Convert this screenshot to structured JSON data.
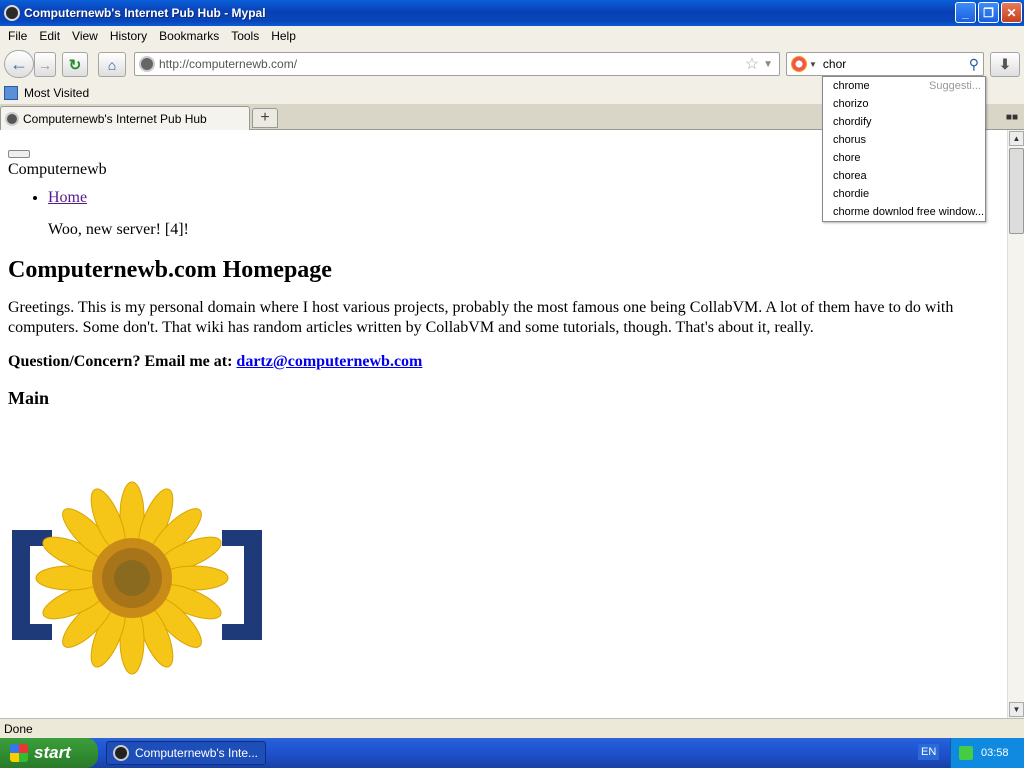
{
  "window": {
    "title": "Computernewb's Internet Pub Hub - Mypal",
    "minimize": "_",
    "restore": "❐",
    "close": "✕"
  },
  "menu": [
    "File",
    "Edit",
    "View",
    "History",
    "Bookmarks",
    "Tools",
    "Help"
  ],
  "nav": {
    "back_icon": "arrow-left-icon",
    "forward_icon": "arrow-right-icon",
    "reload_icon": "reload-icon",
    "home_icon": "home-icon",
    "url": "http://computernewb.com/",
    "search_query": "chor",
    "download_icon": "download-icon"
  },
  "bookmarks": {
    "most_visited": "Most Visited"
  },
  "tabs": [
    {
      "label": "Computernewb's Internet Pub Hub"
    }
  ],
  "new_tab": "+",
  "suggestions": {
    "hint": "Suggesti...",
    "items": [
      "chrome",
      "chorizo",
      "chordify",
      "chorus",
      "chore",
      "chorea",
      "chordie",
      "chorme downlod free window..."
    ]
  },
  "page": {
    "brand": "Computernewb",
    "nav_links": [
      "Home"
    ],
    "news": "Woo, new server! [4]!",
    "heading": "Computernewb.com Homepage",
    "intro": "Greetings. This is my personal domain where I host various projects, probably the most famous one being CollabVM. A lot of them have to do with computers. Some don't. That wiki has random articles written by CollabVM and some tutorials, though. That's about it, really.",
    "contact_label": "Question/Concern? Email me at:",
    "contact_email": "dartz@computernewb.com",
    "section": "Main"
  },
  "status": "Done",
  "taskbar": {
    "start": "start",
    "task": "Computernewb's Inte...",
    "lang": "EN",
    "clock": "03:58"
  },
  "colors": {
    "accent": "#0a5fd8",
    "link": "#0000ee",
    "visited": "#551a8b",
    "taskbar": "#245edb",
    "start": "#2f8a2f"
  }
}
